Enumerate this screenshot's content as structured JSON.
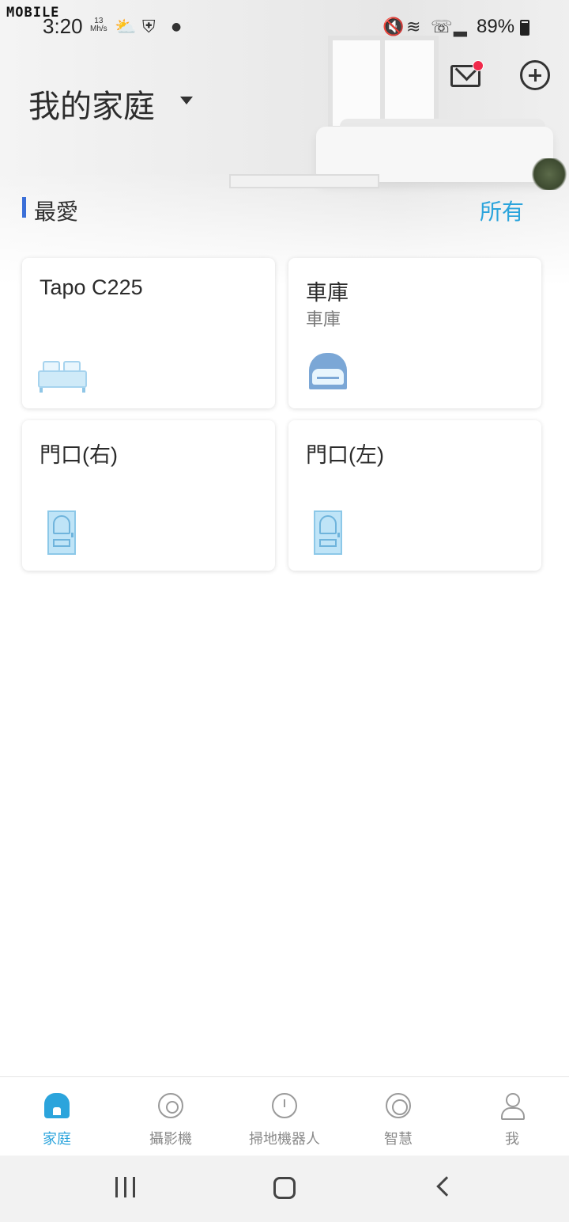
{
  "status_bar": {
    "brand_watermark": "MOBILE",
    "time": "3:20",
    "speed_value": "13",
    "speed_unit": "Mh/s",
    "battery": "89%"
  },
  "header": {
    "home_name": "我的家庭"
  },
  "favorites": {
    "label": "最愛",
    "all_link": "所有",
    "cards": [
      {
        "name": "Tapo C225",
        "room": "",
        "icon": "bed-icon"
      },
      {
        "name": "車庫",
        "room": "車庫",
        "icon": "garage-icon"
      },
      {
        "name": "門口(右)",
        "room": "",
        "icon": "door-icon"
      },
      {
        "name": "門口(左)",
        "room": "",
        "icon": "door-icon"
      }
    ]
  },
  "bottom_nav": {
    "items": [
      {
        "label": "家庭",
        "icon": "home-icon",
        "active": true
      },
      {
        "label": "攝影機",
        "icon": "camera-icon",
        "active": false
      },
      {
        "label": "掃地機器人",
        "icon": "robot-vacuum-icon",
        "active": false
      },
      {
        "label": "智慧",
        "icon": "smart-icon",
        "active": false
      },
      {
        "label": "我",
        "icon": "profile-icon",
        "active": false
      }
    ]
  },
  "colors": {
    "accent": "#2ba4dc",
    "section_bar": "#3b6fd8",
    "notification_dot": "#f0294a"
  }
}
